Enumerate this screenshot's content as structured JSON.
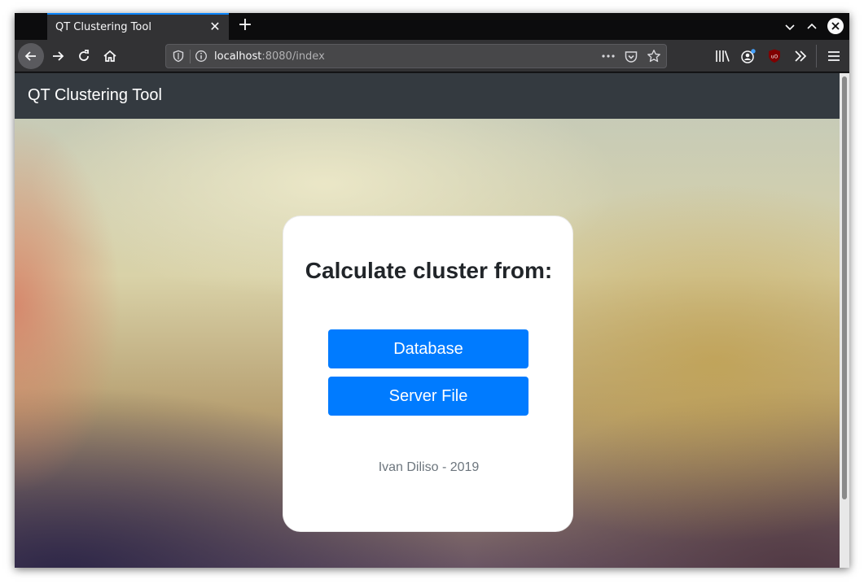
{
  "browser": {
    "tab": {
      "title": "QT Clustering Tool"
    },
    "url": {
      "host": "localhost",
      "rest": ":8080/index"
    },
    "icons": [
      "back-icon",
      "forward-icon",
      "reload-icon",
      "home-icon",
      "shield-icon",
      "info-icon",
      "more-icon",
      "pocket-icon",
      "star-icon",
      "library-icon",
      "account-icon",
      "ublock-icon",
      "overflow-icon",
      "menu-icon"
    ],
    "ublock_badge": "uO"
  },
  "page": {
    "brand": "QT Clustering Tool",
    "card": {
      "title": "Calculate cluster from:",
      "buttons": [
        "Database",
        "Server File"
      ],
      "footer": "Ivan Diliso - 2019"
    }
  },
  "colors": {
    "navbar": "#343a40",
    "primary": "#007bff",
    "tab_accent": "#0a84ff",
    "muted": "#6c757d"
  }
}
